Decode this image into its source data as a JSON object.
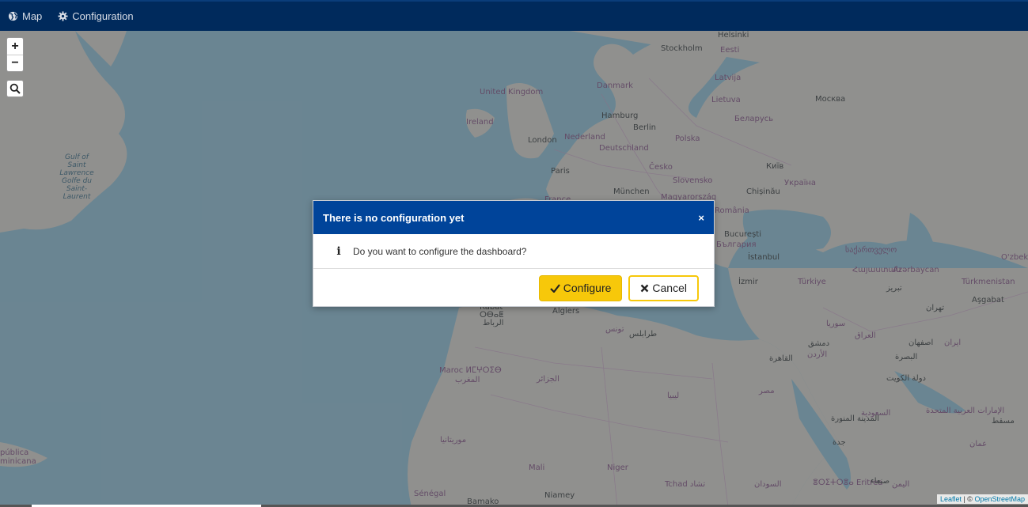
{
  "navbar": {
    "items": [
      {
        "label": "Map",
        "icon": "globe-icon"
      },
      {
        "label": "Configuration",
        "icon": "gear-icon"
      }
    ]
  },
  "map": {
    "controls": {
      "zoom_in": "+",
      "zoom_out": "−"
    },
    "labels": {
      "helsinki": "Helsinki",
      "stockholm": "Stockholm",
      "eesti": "Eesti",
      "latvija": "Latvija",
      "lietuva": "Lietuva",
      "danmark": "Danmark",
      "moskva": "Москва",
      "united_kingdom": "United Kingdom",
      "ireland": "Ireland",
      "hamburg": "Hamburg",
      "berlin": "Berlin",
      "polska": "Polska",
      "belarus": "Беларусь",
      "london": "London",
      "nederland": "Nederland",
      "deutschland": "Deutschland",
      "cesko": "Česko",
      "kyiv": "Київ",
      "paris": "Paris",
      "slovensko": "Slovensko",
      "ukraina": "Україна",
      "munchen": "München",
      "magyarorszag": "Magyarország",
      "chisinau": "Chișinău",
      "france": "France",
      "romania": "România",
      "bucuresti": "București",
      "bulgaria": "България",
      "istanbul": "İstanbul",
      "georgia": "საქართველო",
      "ozbek": "O'zbek",
      "izmir": "İzmir",
      "turkiye": "Türkiye",
      "armenia": "Հայաստան",
      "azerbaycan": "Azərbaycan",
      "turkmenistan": "Türkmenistan",
      "asgabat": "Aşgabat",
      "rabat": "Rabat",
      "rabat_tifinagh": "ⵔⴱⴰⵟ",
      "rabat_ar": "الرباط",
      "algiers": "Algiers",
      "tunis": "تونس",
      "tarabulus": "طرابلس",
      "tehran": "تهران",
      "tabriz": "تبریز",
      "suriya": "سوريا",
      "iraq": "العراق",
      "isfahan": "اصفهان",
      "iran": "ایران",
      "dimashq": "دمشق",
      "urdun": "الأردن",
      "basra": "البصرة",
      "maroc": "Maroc ⵍⵎⵖⵔⵉⴱ",
      "maghrib": "المغرب",
      "jazair": "الجزائر",
      "qahira": "القاهرة",
      "kuwait": "دولة الكويت",
      "libya": "ليبيا",
      "misr": "مصر",
      "gulf_of_st_lawrence": "Gulf of Saint Lawrence Golfe du Saint-Laurent",
      "saudi": "السعودية",
      "emirates": "الإمارات العربية المتحدة",
      "masqat": "مسقط",
      "madinah": "المدينة المنورة",
      "jeddah": "جدة",
      "oman": "عمان",
      "mauritania": "موريتانيا",
      "mali": "Mali",
      "niger": "Niger",
      "tchad": "Tchad تشاد",
      "sudan": "السودان",
      "eritrea": "ⴻⵔⵉⵜⵔⴻⴰ Eritrea",
      "sanaa": "صنعاء",
      "yemen": "اليمن",
      "senegal": "Sénégal",
      "bamako": "Bamako",
      "niamey": "Niamey",
      "republica": "pública",
      "dominicana": "minicana"
    },
    "attribution": {
      "leaflet": "Leaflet",
      "separator": " | © ",
      "osm": "OpenStreetMap"
    }
  },
  "modal": {
    "title": "There is no configuration yet",
    "close": "×",
    "message": "Do you want to configure the dashboard?",
    "info_icon": "i",
    "configure_label": "Configure",
    "cancel_label": "Cancel"
  },
  "colors": {
    "navbar": "#002a5c",
    "modal_header": "#00449a",
    "accent": "#f7c80a",
    "water": "#7593a0",
    "land": "#a89a9a"
  }
}
